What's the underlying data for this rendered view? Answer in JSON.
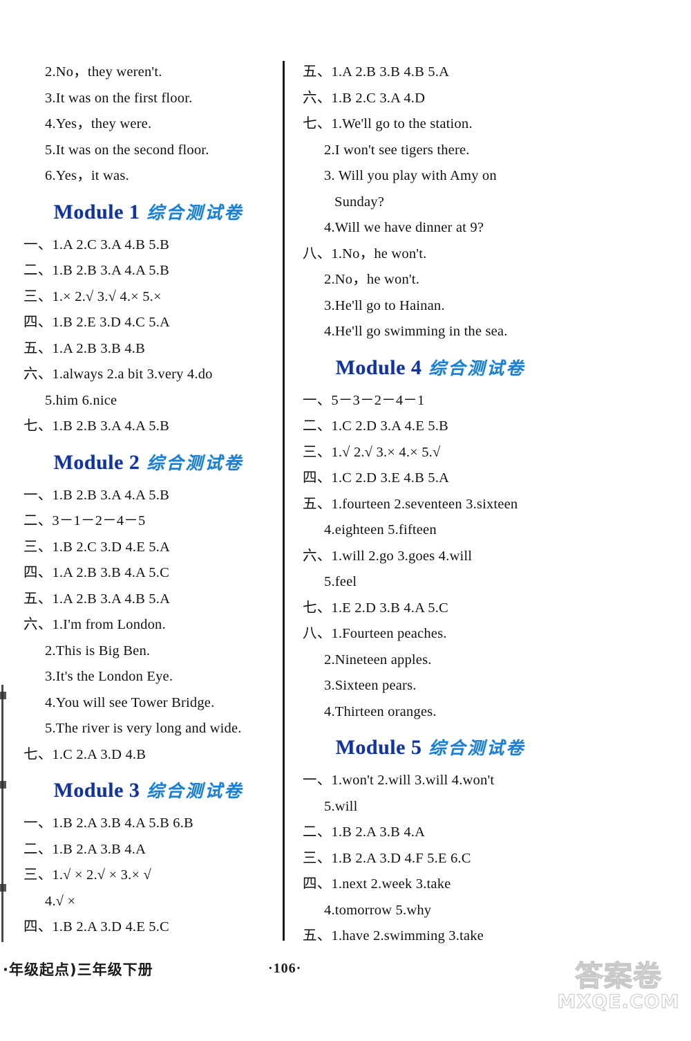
{
  "page": {
    "number": "·106·",
    "footer_left": "·年级起点)三年级下册",
    "watermark_cn": "答案卷",
    "watermark_url": "MXQE.COM",
    "heading_en_color": "#12349a",
    "heading_cn_color": "#1b7fd4"
  },
  "module_suffix_cn": "综合测试卷",
  "left_column": {
    "continued_answers": [
      "2.No，they weren't.",
      "3.It was on the first floor.",
      "4.Yes，they were.",
      "5.It was on the second floor.",
      "6.Yes，it was."
    ],
    "modules": [
      {
        "title_en": "Module 1",
        "title_cn": "综合测试卷",
        "lines": [
          "一、1.A   2.C   3.A   4.B   5.B",
          "二、1.B   2.B   3.A   4.A   5.B",
          "三、1.×   2.√   3.√   4.×   5.×",
          "四、1.B   2.E   3.D   4.C   5.A",
          "五、1.A   2.B   3.B   4.B",
          "六、1.always   2.a bit   3.very   4.do",
          "5.him   6.nice",
          "七、1.B   2.B   3.A   4.A   5.B"
        ]
      },
      {
        "title_en": "Module 2",
        "title_cn": "综合测试卷",
        "lines": [
          "一、1.B   2.B   3.A   4.A   5.B",
          "二、3－1－2－4－5",
          "三、1.B   2.C   3.D   4.E   5.A",
          "四、1.A   2.B   3.B   4.A   5.C",
          "五、1.A   2.B   3.A   4.B   5.A",
          "六、1.I'm from London.",
          "2.This is Big Ben.",
          "3.It's the London Eye.",
          "4.You will see Tower Bridge.",
          "5.The river is very long and wide.",
          "七、1.C   2.A   3.D   4.B"
        ]
      },
      {
        "title_en": "Module 3",
        "title_cn": "综合测试卷",
        "lines": [
          "一、1.B   2.A   3.B   4.A   5.B   6.B",
          "二、1.B   2.A   3.B   4.A",
          "三、1.√    ×    2.√    ×    3.×   √",
          "4.√   ×",
          "四、1.B   2.A   3.D   4.E   5.C"
        ]
      }
    ]
  },
  "right_column": {
    "continued_answers": [
      "五、1.A   2.B   3.B   4.B   5.A",
      "六、1.B   2.C   3.A   4.D",
      "七、1.We'll go to the station.",
      "2.I won't see tigers there.",
      "3. Will you play with Amy on",
      "Sunday?",
      "4.Will we have dinner at 9?",
      "八、1.No，he won't.",
      "2.No，he won't.",
      "3.He'll go to Hainan.",
      "4.He'll go swimming in the sea."
    ],
    "modules": [
      {
        "title_en": "Module 4",
        "title_cn": "综合测试卷",
        "lines": [
          "一、5－3－2－4－1",
          "二、1.C   2.D   3.A   4.E   5.B",
          "三、1.√   2.√   3.×   4.×   5.√",
          "四、1.C   2.D   3.E   4.B   5.A",
          "五、1.fourteen   2.seventeen   3.sixteen",
          "4.eighteen   5.fifteen",
          "六、1.will   2.go   3.goes   4.will",
          "5.feel",
          "七、1.E   2.D   3.B   4.A   5.C",
          "八、1.Fourteen peaches.",
          "2.Nineteen apples.",
          "3.Sixteen pears.",
          "4.Thirteen oranges."
        ]
      },
      {
        "title_en": "Module 5",
        "title_cn": "综合测试卷",
        "lines": [
          "一、1.won't   2.will   3.will   4.won't",
          "5.will",
          "二、1.B   2.A   3.B   4.A",
          "三、1.B   2.A   3.D   4.F   5.E   6.C",
          "四、1.next   2.week   3.take",
          "4.tomorrow   5.why",
          "五、1.have   2.swimming   3.take"
        ]
      }
    ]
  }
}
